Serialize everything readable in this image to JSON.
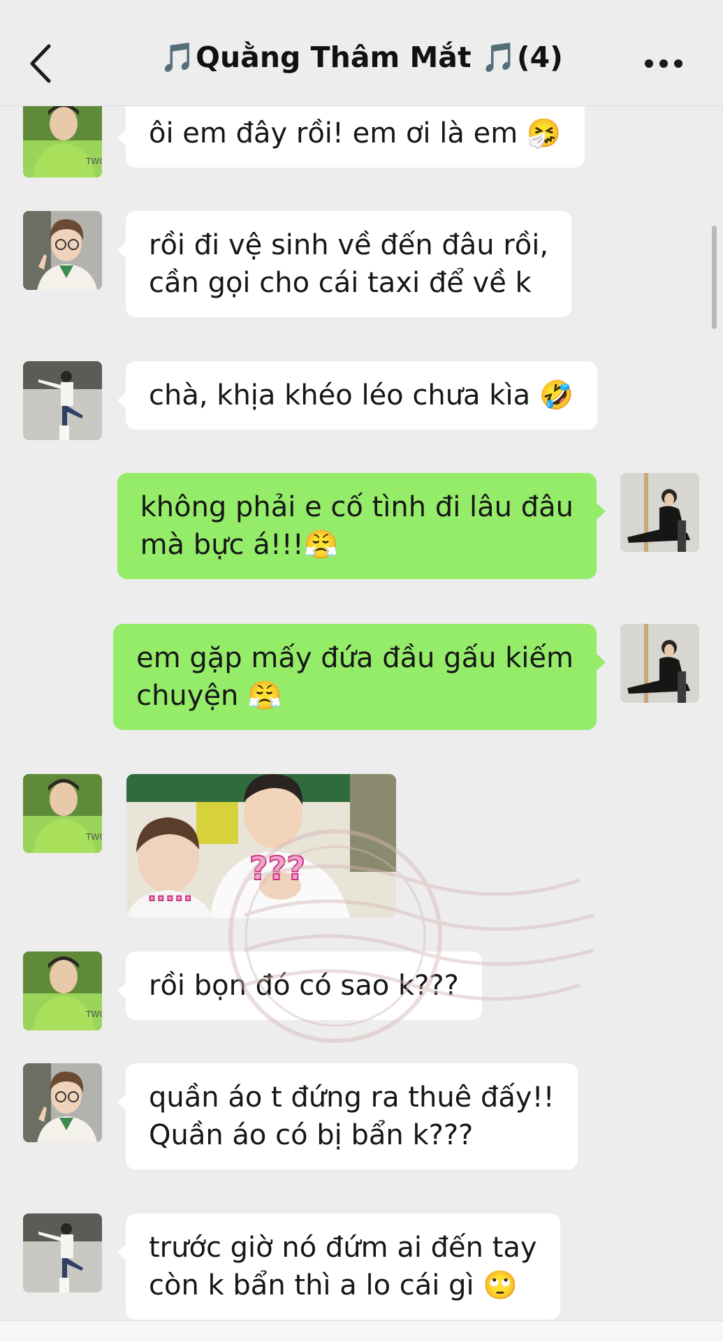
{
  "header": {
    "title": "🎵Quằng Thâm Mắt 🎵(4)",
    "back_icon": "chevron-left-icon",
    "more_icon": "more-dots-icon"
  },
  "colors": {
    "background": "#ededed",
    "incoming_bubble": "#ffffff",
    "outgoing_bubble": "#95ec69",
    "text": "#161616"
  },
  "messages": [
    {
      "direction": "incoming",
      "sender": "member-green-shirt",
      "text": "ôi em đây rồi! em ơi là em 🤧"
    },
    {
      "direction": "incoming",
      "sender": "member-glasses",
      "text": "rồi đi vệ sinh về đến đâu rồi,\ncần gọi cho cái taxi để về k"
    },
    {
      "direction": "incoming",
      "sender": "member-standing",
      "text": "chà, khịa khéo léo chưa kìa 🤣"
    },
    {
      "direction": "outgoing",
      "sender": "me",
      "text": "không phải e cố tình đi lâu đâu\nmà bực á!!!😤"
    },
    {
      "direction": "outgoing",
      "sender": "me",
      "text": "em gặp mấy đứa đầu gấu kiếm\nchuyện 😤"
    },
    {
      "direction": "incoming",
      "sender": "member-green-shirt",
      "type": "sticker",
      "sticker_text": "???",
      "sticker_dots": "....."
    },
    {
      "direction": "incoming",
      "sender": "member-green-shirt",
      "text": "rồi bọn đó có sao k???"
    },
    {
      "direction": "incoming",
      "sender": "member-glasses",
      "text": "quần áo t đứng ra thuê đấy!!\nQuần áo có bị bẩn k???"
    },
    {
      "direction": "incoming",
      "sender": "member-standing",
      "text": "trước giờ nó đứm ai đến tay\ncòn k bẩn thì a lo cái gì 🙄"
    }
  ]
}
